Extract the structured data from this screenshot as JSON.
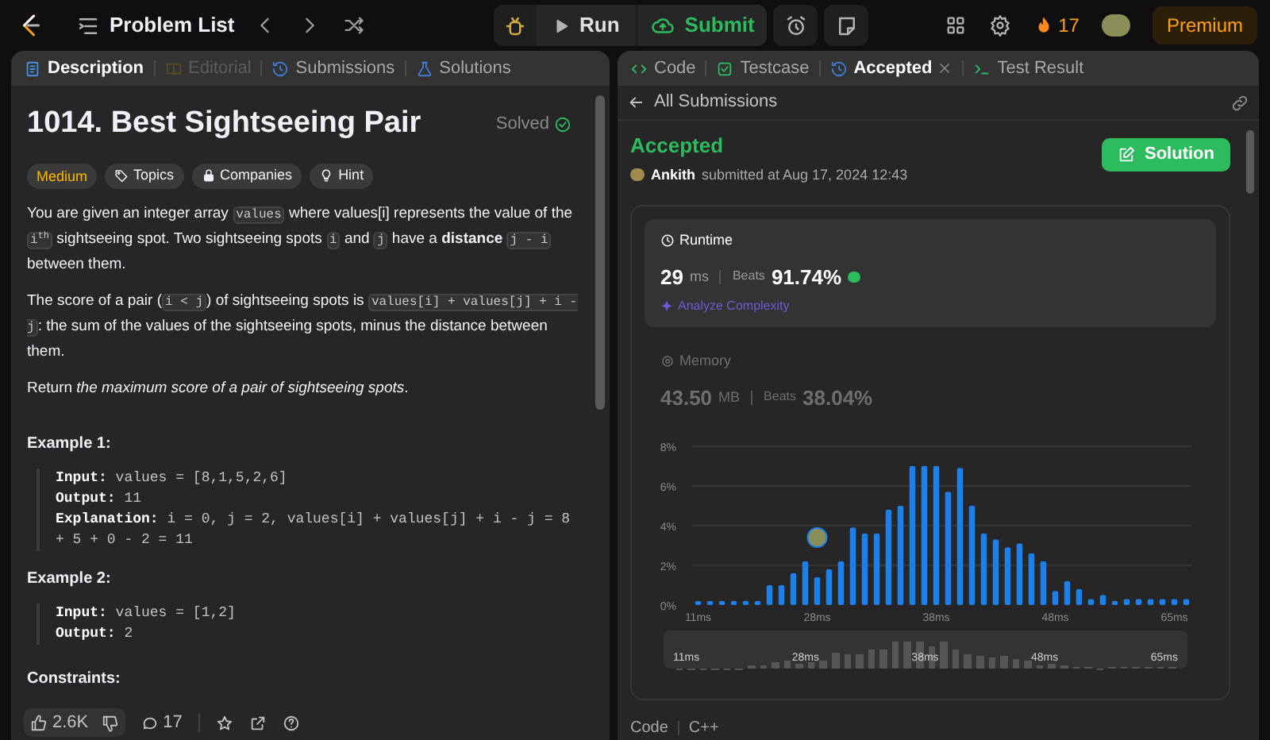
{
  "topbar": {
    "problem_list": "Problem List",
    "run": "Run",
    "submit": "Submit",
    "streak": "17",
    "premium": "Premium"
  },
  "left_tabs": [
    {
      "label": "Description",
      "selected": true,
      "disabled": false
    },
    {
      "label": "Editorial",
      "selected": false,
      "disabled": true
    },
    {
      "label": "Submissions",
      "selected": false,
      "disabled": false
    },
    {
      "label": "Solutions",
      "selected": false,
      "disabled": false
    }
  ],
  "problem": {
    "title": "1014. Best Sightseeing Pair",
    "status": "Solved",
    "difficulty": "Medium",
    "tags": [
      "Topics",
      "Companies",
      "Hint"
    ],
    "paragraphs": [
      [
        {
          "kind": "text",
          "text": "You are given an integer array "
        },
        {
          "kind": "code",
          "text": "values"
        },
        {
          "kind": "text",
          "text": " where values[i] represents the value of the "
        },
        {
          "kind": "code",
          "text": "i$^{th}$"
        },
        {
          "kind": "text",
          "text": " sightseeing spot. Two sightseeing spots "
        },
        {
          "kind": "code",
          "text": "i"
        },
        {
          "kind": "text",
          "text": " and "
        },
        {
          "kind": "code",
          "text": "j"
        },
        {
          "kind": "text",
          "text": " have a **distance** "
        },
        {
          "kind": "code",
          "text": "j - i"
        },
        {
          "kind": "text",
          "text": " between them."
        }
      ],
      [
        {
          "kind": "text",
          "text": "The score of a pair ("
        },
        {
          "kind": "code",
          "text": "i < j"
        },
        {
          "kind": "text",
          "text": ") of sightseeing spots is "
        },
        {
          "kind": "code",
          "text": "values[i] + values[j] + i - j"
        },
        {
          "kind": "text",
          "text": ": the sum of the values of the sightseeing spots, minus the distance between them."
        }
      ],
      [
        {
          "kind": "text",
          "text": "Return *the maximum score of a pair of sightseeing spots*."
        }
      ]
    ],
    "examples": [
      {
        "title": "Example 1:",
        "lines": [
          {
            "label": "Input:",
            "value": "values = [8,1,5,2,6]"
          },
          {
            "label": "Output:",
            "value": "11"
          },
          {
            "label": "Explanation:",
            "value": "i = 0, j = 2, values[i] + values[j] + i - j = 8 + 5 + 0 - 2 = 11"
          }
        ]
      },
      {
        "title": "Example 2:",
        "lines": [
          {
            "label": "Input:",
            "value": "values = [1,2]"
          },
          {
            "label": "Output:",
            "value": "2"
          }
        ]
      }
    ],
    "constraints_heading": "Constraints:",
    "likes": "2.6K",
    "comments": "17"
  },
  "right_tabs": [
    {
      "label": "Code",
      "selected": false,
      "closable": false
    },
    {
      "label": "Testcase",
      "selected": false,
      "closable": false
    },
    {
      "label": "Accepted",
      "selected": true,
      "closable": true
    },
    {
      "label": "Test Result",
      "selected": false,
      "closable": false
    }
  ],
  "submission": {
    "back": "All Submissions",
    "verdict": "Accepted",
    "user": "Ankith",
    "submitted": "submitted at Aug 17, 2024 12:43",
    "solution_button": "Solution",
    "metrics": [
      {
        "title": "Runtime",
        "value": "29",
        "unit": "ms",
        "beats_label": "Beats",
        "beats": "91.74%",
        "selected": true,
        "link": "Analyze Complexity"
      },
      {
        "title": "Memory",
        "value": "43.50",
        "unit": "MB",
        "beats_label": "Beats",
        "beats": "38.04%",
        "selected": false
      }
    ],
    "chart_data": {
      "type": "bar",
      "yticks": [
        {
          "value": 0,
          "label": "0%"
        },
        {
          "value": 2,
          "label": "2%"
        },
        {
          "value": 4,
          "label": "4%"
        },
        {
          "value": 6,
          "label": "6%"
        },
        {
          "value": 8,
          "label": "8%"
        }
      ],
      "ylim": [
        0,
        8
      ],
      "grid": true,
      "categories": [
        "11ms",
        null,
        null,
        null,
        null,
        null,
        null,
        null,
        null,
        null,
        "28ms",
        null,
        null,
        null,
        null,
        null,
        null,
        null,
        null,
        null,
        "38ms",
        null,
        null,
        null,
        null,
        null,
        null,
        null,
        null,
        null,
        "48ms",
        null,
        null,
        null,
        null,
        null,
        null,
        null,
        null,
        null,
        "65ms",
        null
      ],
      "series": [
        {
          "color": "#1d7fea",
          "values": [
            0.2,
            0.2,
            0.2,
            0.2,
            0.2,
            0.2,
            1.0,
            1.0,
            1.6,
            2.2,
            1.4,
            1.8,
            2.2,
            3.9,
            3.6,
            3.6,
            4.8,
            5.0,
            7.0,
            7.0,
            7.0,
            5.7,
            6.9,
            5.0,
            3.6,
            3.3,
            2.9,
            3.1,
            2.6,
            2.2,
            0.7,
            1.2,
            0.8,
            0.3,
            0.5,
            0.2,
            0.3,
            0.3,
            0.3,
            0.3,
            0.3,
            0.3
          ]
        }
      ]
    },
    "range_labels": [
      "11ms",
      "28ms",
      "38ms",
      "48ms",
      "65ms"
    ],
    "code_label": "Code",
    "language": "C++"
  }
}
